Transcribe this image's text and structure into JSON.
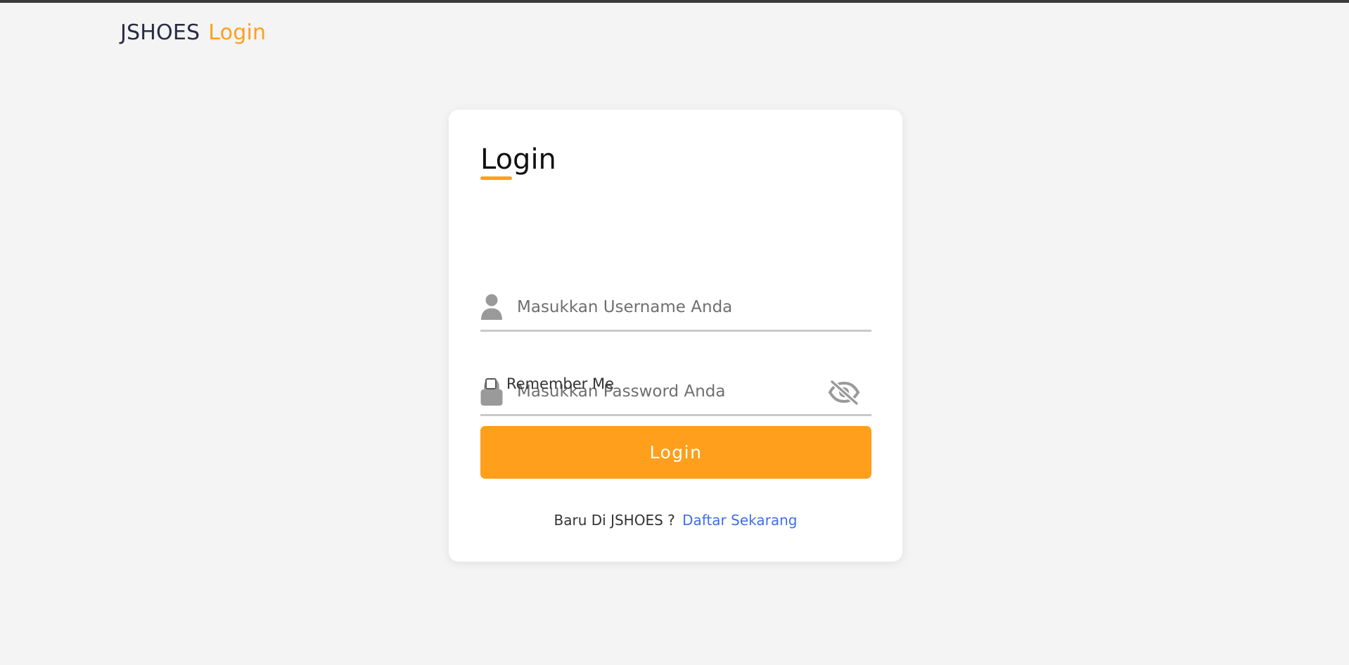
{
  "header": {
    "brand_name": "JSHOES",
    "page_label": "Login"
  },
  "login_card": {
    "title": "Login",
    "username": {
      "placeholder": "Masukkan Username Anda",
      "value": "",
      "icon": "user-icon"
    },
    "password": {
      "placeholder": "Masukkan Password Anda",
      "value": "",
      "icon": "lock-icon",
      "toggle_icon": "eye-slash-icon"
    },
    "remember_me": {
      "label": "Remember Me",
      "checked": false
    },
    "submit_label": "Login",
    "register_prompt": "Baru Di JSHOES ?",
    "register_link": "Daftar Sekarang"
  },
  "colors": {
    "accent": "#ff9f1c",
    "link": "#3f6fe6",
    "background": "#f4f4f4",
    "card": "#ffffff",
    "icon_gray": "#9a9a9a"
  }
}
